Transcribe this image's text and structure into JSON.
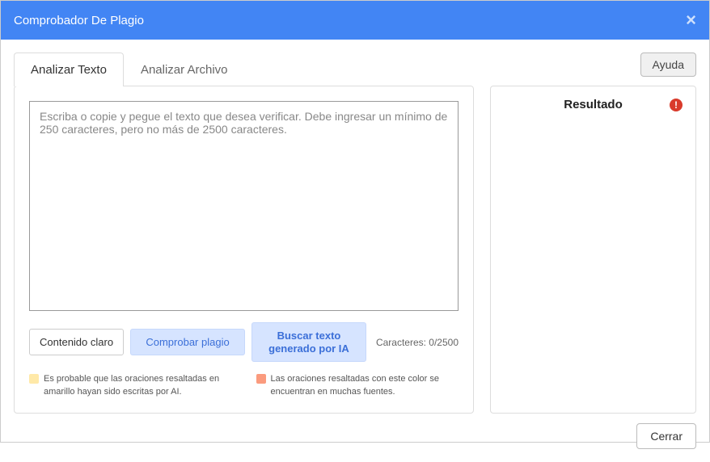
{
  "header": {
    "title": "Comprobador De Plagio"
  },
  "tabs": {
    "analyze_text": "Analizar Texto",
    "analyze_file": "Analizar Archivo"
  },
  "help_label": "Ayuda",
  "textarea": {
    "placeholder": "Escriba o copie y pegue el texto que desea verificar. Debe ingresar un mínimo de 250 caracteres, pero no más de 2500 caracteres."
  },
  "buttons": {
    "clear": "Contenido claro",
    "check": "Comprobar plagio",
    "ai": "Buscar texto generado por IA"
  },
  "char_counter": "Caracteres: 0/2500",
  "legend": {
    "yellow_text": "Es probable que las oraciones resaltadas en amarillo hayan sido escritas por AI.",
    "orange_text": "Las oraciones resaltadas con este color se encuentran en muchas fuentes."
  },
  "result": {
    "title": "Resultado"
  },
  "footer": {
    "close": "Cerrar"
  }
}
